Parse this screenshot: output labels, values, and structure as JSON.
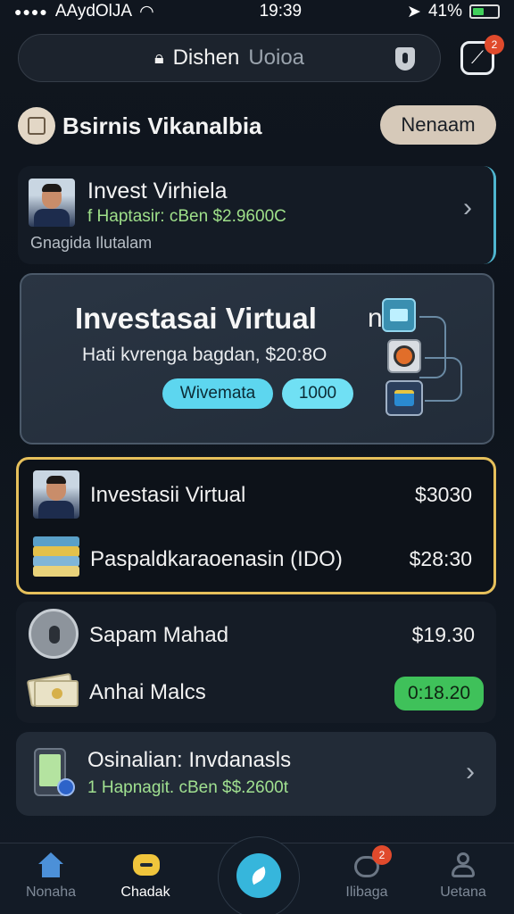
{
  "status_bar": {
    "carrier": "AAydOlJA",
    "time": "19:39",
    "battery": "41%"
  },
  "search": {
    "label": "Dishen",
    "placeholder": "Uoioa"
  },
  "notification_badge": "2",
  "header": {
    "title": "Bsirnis Vikanalbia",
    "button": "Nenaam"
  },
  "card_top": {
    "title": "Invest Virhiela",
    "subtitle": "f Haptasir: cBen $2.9600C",
    "footer": "Gnagida Ilutalam"
  },
  "hero": {
    "title": "Investasai Virtual",
    "title_suffix": "n",
    "subtitle": "Hati kvrenga bagdan, $20:8O",
    "pill_primary": "Wivemata",
    "pill_secondary": "1000"
  },
  "portfolio_highlight": [
    {
      "label": "Investasii Virtual",
      "value": "$3030"
    },
    {
      "label": "Paspaldkaraoenasin (IDO)",
      "value": "$28:30"
    }
  ],
  "portfolio_other": [
    {
      "label": "Sapam Mahad",
      "value": "$19.30"
    },
    {
      "label": "Anhai Malcs",
      "value": "0:18.20"
    }
  ],
  "card_bottom": {
    "title": "Osinalian: Invdanasls",
    "subtitle": "1 Hapnagit. cBen $$.2600t"
  },
  "nav": {
    "home": "Nonaha",
    "chat": "Chadak",
    "messages": "Ilibaga",
    "messages_badge": "2",
    "profile": "Uetana"
  },
  "colors": {
    "accent_cyan": "#5dd6ef",
    "highlight_border": "#e6c05b",
    "positive_green": "#3fc15a",
    "badge_red": "#e04a2c"
  }
}
